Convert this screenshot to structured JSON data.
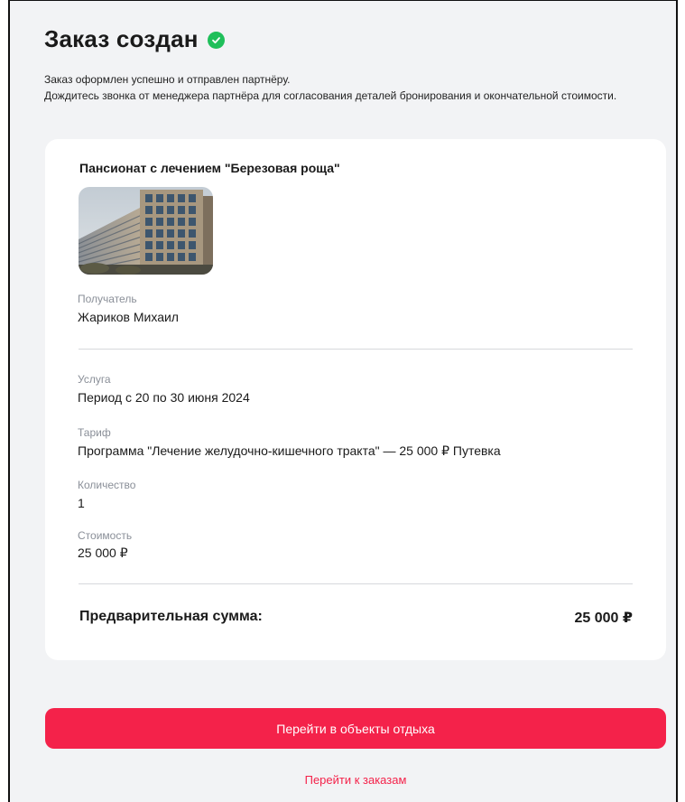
{
  "header": {
    "title": "Заказ создан",
    "status_icon": "check-circle-icon",
    "status_color": "#1fbf5a"
  },
  "intro": {
    "line1": "Заказ оформлен успешно и отправлен партнёру.",
    "line2": "Дождитесь звонка от менеджера партнёра для согласования деталей бронирования и окончательной стоимости."
  },
  "order": {
    "hotel_name": "Пансионат с лечением \"Березовая роща\"",
    "recipient": {
      "label": "Получатель",
      "value": "Жариков Михаил"
    },
    "service": {
      "label": "Услуга",
      "value": "Период с 20 по 30 июня 2024"
    },
    "tariff": {
      "label": "Тариф",
      "value": "Программа \"Лечение желудочно-кишечного тракта\" — 25 000 ₽ Путевка"
    },
    "quantity": {
      "label": "Количество",
      "value": "1"
    },
    "cost": {
      "label": "Стоимость",
      "value": "25 000 ₽"
    },
    "total": {
      "label": "Предварительная сумма:",
      "value": "25 000 ₽"
    }
  },
  "actions": {
    "primary_label": "Перейти в объекты отдыха",
    "secondary_label": "Перейти к заказам",
    "accent_color": "#f4224a"
  }
}
